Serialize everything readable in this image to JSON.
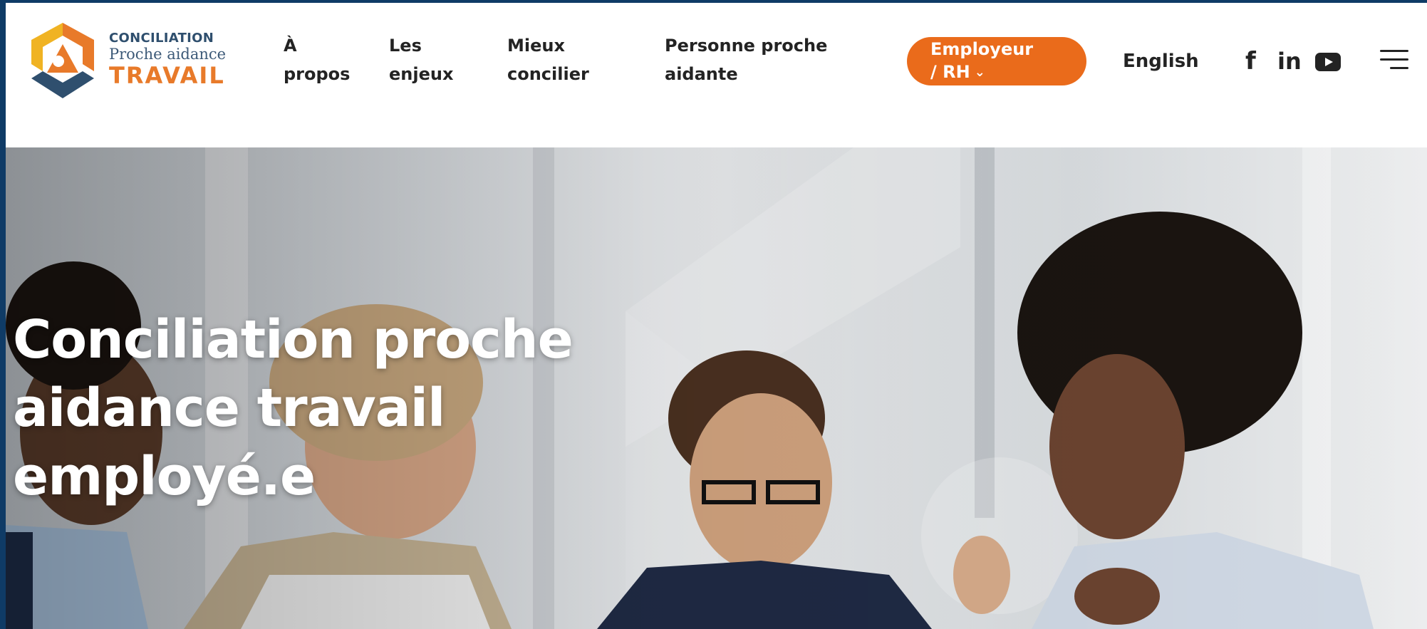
{
  "logo": {
    "line1": "CONCILIATION",
    "line2": "Proche aidance",
    "line3": "TRAVAIL"
  },
  "nav": {
    "about": {
      "line1": "À",
      "line2": "propos"
    },
    "issues": {
      "line1": "Les",
      "line2": "enjeux"
    },
    "reconcile": {
      "line1": "Mieux",
      "line2": "concilier"
    },
    "caregiver": {
      "line1": "Personne proche",
      "line2": "aidante"
    }
  },
  "cta": {
    "line1": "Employeur",
    "line2": "/ RH",
    "chevron": "⌄"
  },
  "language": "English",
  "social": {
    "facebook": {
      "glyph": "f",
      "icon": "facebook-icon"
    },
    "linkedin": {
      "glyph": "in",
      "icon": "linkedin-icon"
    },
    "youtube": {
      "icon": "youtube-icon"
    }
  },
  "menu_icon": "hamburger-menu-icon",
  "hero": {
    "title_line1": "Conciliation proche",
    "title_line2": "aidance travail",
    "title_line3": "employé.e"
  },
  "colors": {
    "accent": "#ea6b1b",
    "logo_orange": "#e87a2a",
    "logo_yellow": "#f0b323",
    "logo_navy": "#2f4f6e",
    "frame": "#0f3b66",
    "nav_text": "#232323"
  }
}
